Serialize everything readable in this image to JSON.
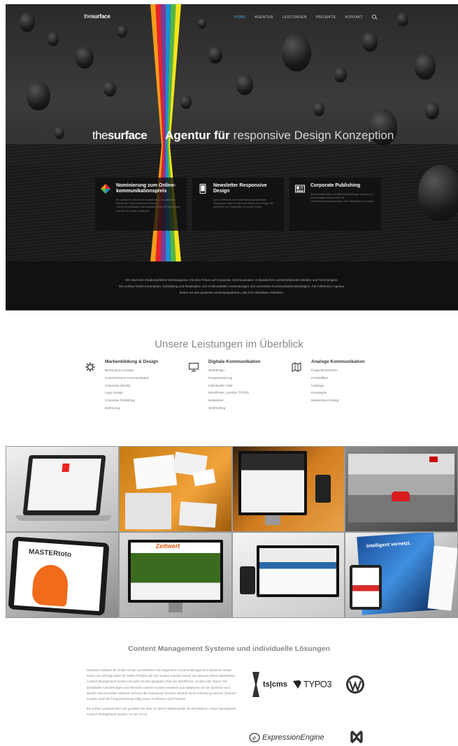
{
  "header": {
    "logo_light": "the",
    "logo_bold": "surface",
    "nav": [
      {
        "label": "HOME",
        "active": true
      },
      {
        "label": "AGENTUR",
        "active": false
      },
      {
        "label": "LEISTUNGEN",
        "active": false
      },
      {
        "label": "PROJEKTE",
        "active": false
      },
      {
        "label": "KONTAKT",
        "active": false
      }
    ],
    "search_icon": "search-icon"
  },
  "hero": {
    "brand_light": "the",
    "brand_bold": "surface",
    "headline_strong": "Agentur für",
    "headline_light": "responsive Design Konzeption",
    "stripe_colors": [
      "#f59c1a",
      "#e8222d",
      "#7a3d96",
      "#1a8fd5",
      "#52b648",
      "#f5e41a"
    ]
  },
  "cards": [
    {
      "icon": "award-diamond-icon",
      "title": "Nominierung zum Online-kommunikationspreis",
      "text": "the surface ist nicht für die Nominierung \"Innovativstes Webdesign\" beim Deutschen Preis für Onlinekommunikation und insgesamt unter 100 Bewerbern Jury für die Shortlist qualifiziert."
    },
    {
      "icon": "smartphone-icon",
      "title": "Newsletter Responsive Design",
      "text": "Auch im Bereich der E-Mail-Marketing Newsletter Kampagnen legen wir Wert auf Responsive Design. Wir optimieren Ihre Newsletter für mobile Geräte."
    },
    {
      "icon": "newspaper-icon",
      "title": "Corporate Publishing",
      "text": "Kundenzeitschriften und Mitarbeiterzeitungen gehören zu den wichtigen Instrumenten der Unternehmenskommunikation. Wir unterstützen Sie dabei."
    }
  ],
  "intro": {
    "line1": "Wir sind eine inhabergeführte Werbeagentur mit dem Fokus auf Corporate Communication in klassischen werbetreibenden Medien und Technologien.",
    "line2": "the surface bietet Konzeption, Gestaltung und Realisation von multimedialen Anwendungen und vernetzten Kommunikationsstrategien. Als Fullservice-Agentur",
    "line3": "bieten wir das gesamte Leistungsspektrum, das Ihre Aktivitäten erfordern."
  },
  "services": {
    "title": "Unsere Leistungen im Überblick",
    "columns": [
      {
        "icon": "gear-icon",
        "heading": "Markenbildung & Design",
        "items": [
          "Beratung & Konzept",
          "Unternehmens Kommunikation",
          "Corporate Identity",
          "Logo Design",
          "Corporate Publishing",
          "Betreuung"
        ]
      },
      {
        "icon": "monitor-icon",
        "heading": "Digitale Kommunikation",
        "items": [
          "Webdesign",
          "Programmierung",
          "Individuelle CMS",
          "WordPress, Joomla, TYPO3",
          "Newsletter",
          "Webhosting"
        ]
      },
      {
        "icon": "map-icon",
        "heading": "Analoge Kommunikation",
        "items": [
          "Image Broschüren",
          "Produktflyer",
          "Kataloge",
          "Kampagne",
          "Messestand Design"
        ]
      }
    ]
  },
  "portfolio": {
    "tiles": [
      {
        "name": "laptop-mockup",
        "bg": "#d9d9d9"
      },
      {
        "name": "stationery-mockup",
        "bg": "#d88a1a"
      },
      {
        "name": "monitor-planet-mockup",
        "bg": "#c26b12"
      },
      {
        "name": "racing-game-mockup",
        "bg": "#7a7a7a"
      },
      {
        "name": "mastertoto-tablet-mockup",
        "bg": "#5a5a5a",
        "label": "MASTERtoto"
      },
      {
        "name": "zeitwert-monitor-mockup",
        "bg": "#bdbdbd",
        "label": "Zeitwert"
      },
      {
        "name": "brochure-devices-mockup",
        "bg": "#e2e2e2"
      },
      {
        "name": "intelligent-brochure-mockup",
        "bg": "#d3d3d3",
        "label": "Intelligent vernetzt."
      }
    ]
  },
  "cms": {
    "title": "Content Management Systeme und individuelle Lösungen",
    "paragraph1": "Standard Software für Online Shops und Websites mit integriertem Content Management Systemen stellen heute eine wichtige Basis für Online Projekte dar. the surface arbeitet sowohl mit eigenem selbst entwickelten Content Management System als auch mit den gängigen CMS wie WordPress, Joomla oder Typo3. Für individuelle Anforderungen und Wünsche unserer Kunden erweitern und adaptieren wir die Systeme nach Bedarf. Das beinhaltet natürlich nicht nur die Anpassung einzelner Module durch Anbindung externer Systeme sondern auch die Programmierung völlig neuer Funktionen und Features.",
    "paragraph2": "the surface programmiert und gestaltet seit über 10 Jahren Webprodukte der Extraklasse. Unser hauseigenes Content Management System, ts-cms ist ein",
    "logos": {
      "tscms": "ts|cms",
      "typo3": "TYPO3",
      "expressionengine": "ExpressionEngine",
      "wordpress_icon": "wordpress-icon",
      "joomla_icon": "joomla-icon"
    }
  }
}
